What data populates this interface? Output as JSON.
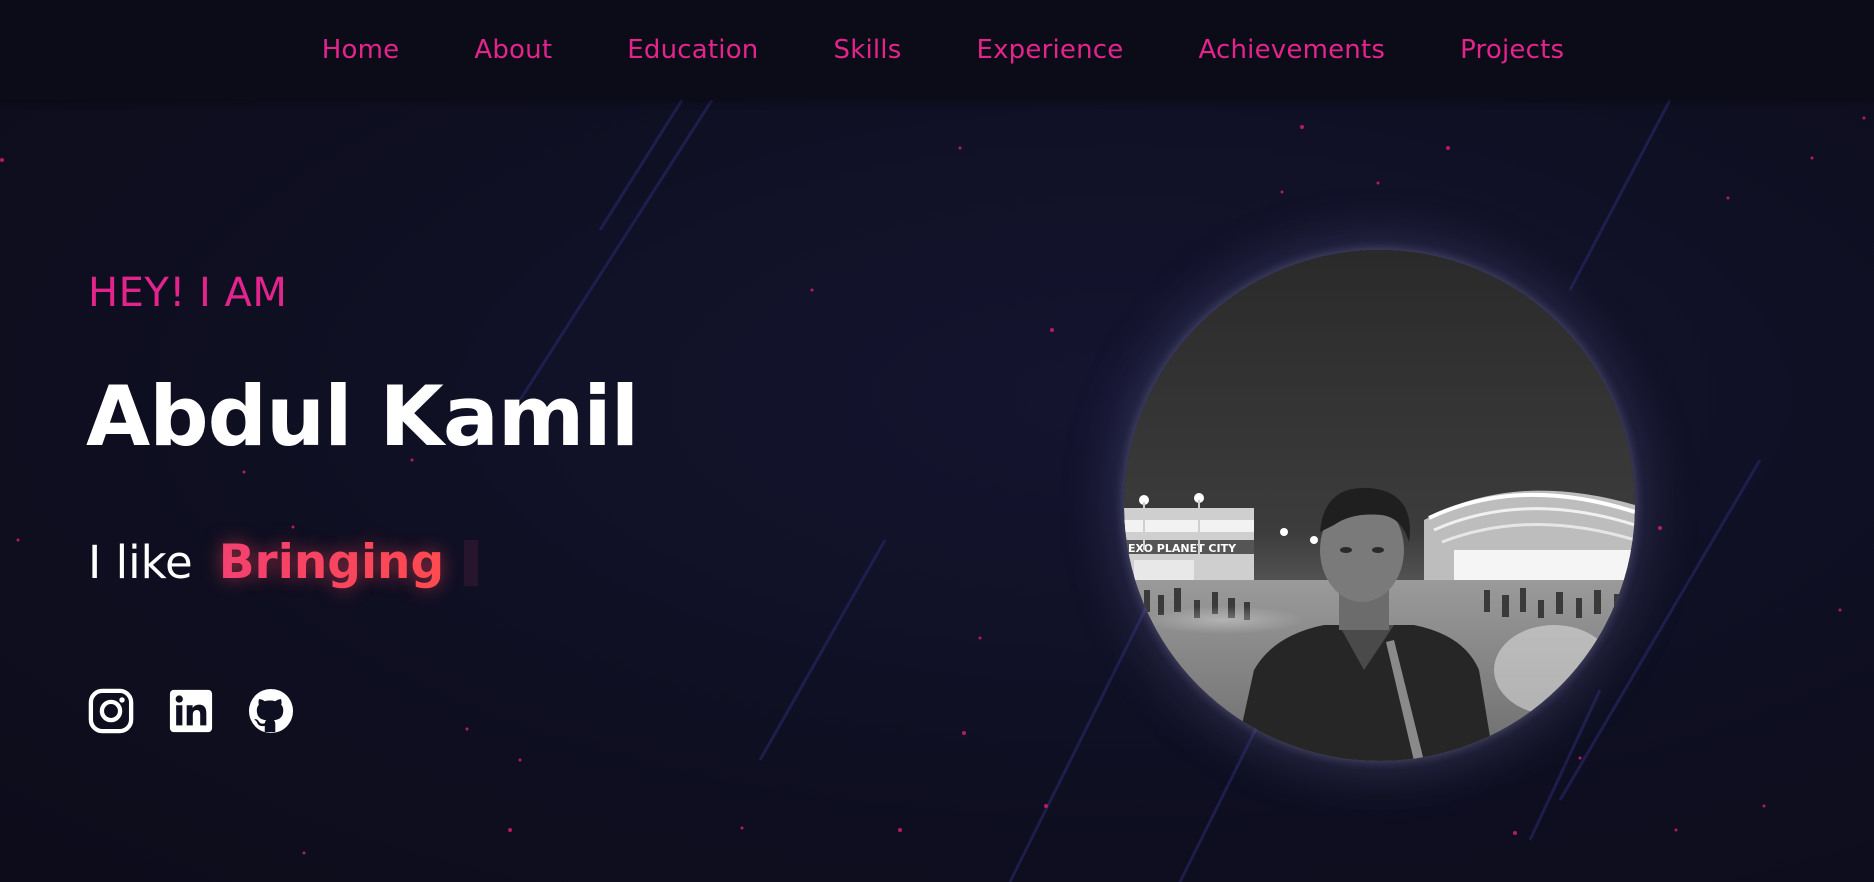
{
  "nav": {
    "items": [
      {
        "label": "Home"
      },
      {
        "label": "About"
      },
      {
        "label": "Education"
      },
      {
        "label": "Skills"
      },
      {
        "label": "Experience"
      },
      {
        "label": "Achievements"
      },
      {
        "label": "Projects"
      }
    ]
  },
  "hero": {
    "greeting": "HEY! I AM",
    "name": "Abdul Kamil",
    "tagline_prefix": "I like",
    "tagline_word": "Bringing"
  },
  "avatar_sign_text": "EXO PLANET CITY",
  "socials": [
    {
      "icon": "instagram-icon"
    },
    {
      "icon": "linkedin-icon"
    },
    {
      "icon": "github-icon"
    }
  ],
  "colors": {
    "accent": "#e3248c",
    "highlight": "#ff4d4d",
    "background": "#0f0f20",
    "text": "#ffffff"
  }
}
